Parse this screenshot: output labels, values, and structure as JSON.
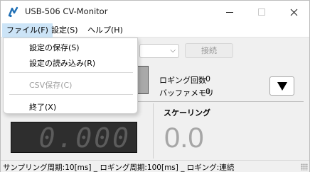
{
  "window": {
    "title": "USB-506 CV-Monitor",
    "icon": "app-icon",
    "controls": [
      "minimize-icon",
      "maximize-icon",
      "close-icon"
    ]
  },
  "menubar": {
    "items": [
      {
        "label": "ファイル(F)",
        "active": true
      },
      {
        "label": "設定(S)"
      },
      {
        "label": "ヘルプ(H)"
      }
    ]
  },
  "file_menu": {
    "items": [
      {
        "label": "設定の保存(S)",
        "enabled": true
      },
      {
        "label": "設定の読み込み(R)",
        "enabled": true
      },
      {
        "label": "CSV保存(C)",
        "enabled": false
      },
      {
        "label": "終了(X)",
        "enabled": true
      }
    ]
  },
  "toolbar": {
    "combo_value": "",
    "connect_label": "接続",
    "connect_enabled": false
  },
  "stats": {
    "logging_count_label": "ロギング回数",
    "logging_count_value": "0",
    "buffer_memory_label": "バッファメモリ",
    "buffer_memory_value": "0"
  },
  "readout": {
    "display_value": "0.000",
    "scaling_label": "スケーリング",
    "scaling_value": "0.0"
  },
  "statusbar": {
    "text": "サンプリング周期:10[ms] _ ロギング周期:100[ms] _ ロギング:連続"
  },
  "colors": {
    "menu_active_bg": "#cce4f7",
    "lcd_bg": "#2e2e2e",
    "lcd_digits": "#5c5c5c",
    "scaling_text": "#a6a6a6"
  }
}
